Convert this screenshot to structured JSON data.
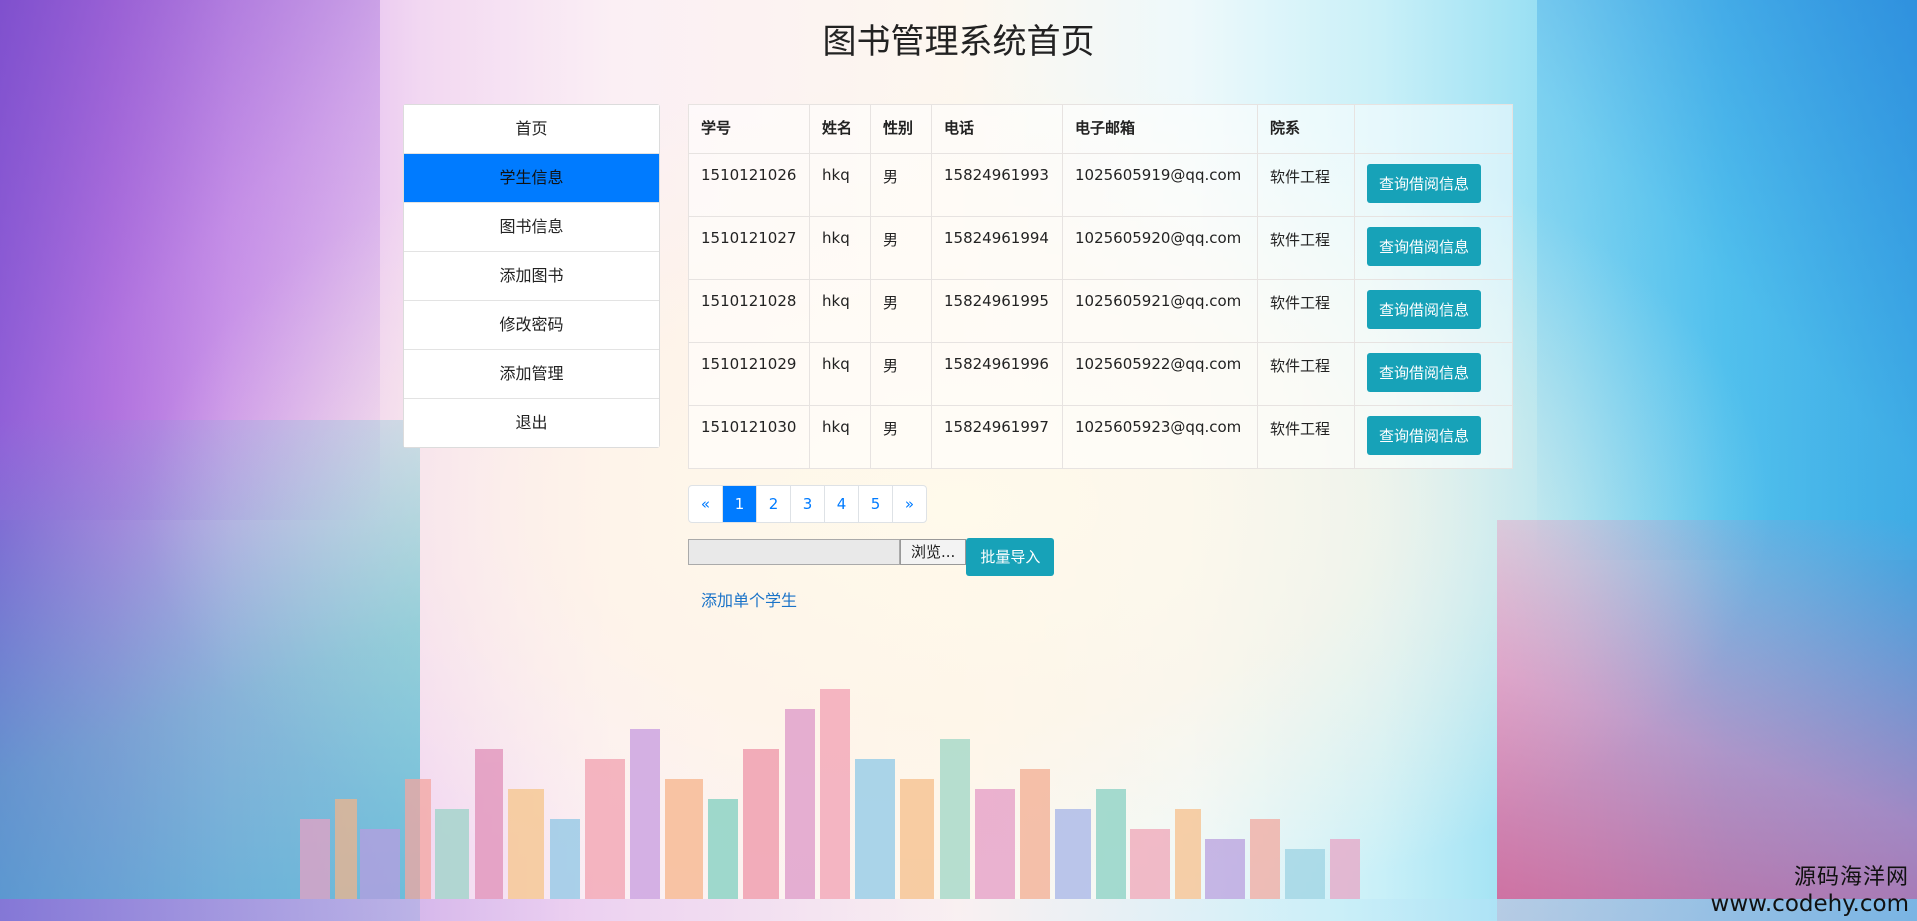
{
  "page": {
    "title": "图书管理系统首页"
  },
  "sidebar": {
    "items": [
      {
        "label": "首页",
        "active": false
      },
      {
        "label": "学生信息",
        "active": true
      },
      {
        "label": "图书信息",
        "active": false
      },
      {
        "label": "添加图书",
        "active": false
      },
      {
        "label": "修改密码",
        "active": false
      },
      {
        "label": "添加管理",
        "active": false
      },
      {
        "label": "退出",
        "active": false
      }
    ]
  },
  "table": {
    "headers": [
      "学号",
      "姓名",
      "性别",
      "电话",
      "电子邮箱",
      "院系",
      ""
    ],
    "action_label": "查询借阅信息",
    "rows": [
      {
        "id": "1510121026",
        "name": "hkq",
        "gender": "男",
        "phone": "15824961993",
        "email": "1025605919@qq.com",
        "dept": "软件工程"
      },
      {
        "id": "1510121027",
        "name": "hkq",
        "gender": "男",
        "phone": "15824961994",
        "email": "1025605920@qq.com",
        "dept": "软件工程"
      },
      {
        "id": "1510121028",
        "name": "hkq",
        "gender": "男",
        "phone": "15824961995",
        "email": "1025605921@qq.com",
        "dept": "软件工程"
      },
      {
        "id": "1510121029",
        "name": "hkq",
        "gender": "男",
        "phone": "15824961996",
        "email": "1025605922@qq.com",
        "dept": "软件工程"
      },
      {
        "id": "1510121030",
        "name": "hkq",
        "gender": "男",
        "phone": "15824961997",
        "email": "1025605923@qq.com",
        "dept": "软件工程"
      }
    ]
  },
  "pagination": {
    "prev": "«",
    "pages": [
      "1",
      "2",
      "3",
      "4",
      "5"
    ],
    "current": "1",
    "next": "»"
  },
  "import": {
    "browse_label": "浏览...",
    "import_label": "批量导入"
  },
  "add_student_link": "添加单个学生",
  "watermark": {
    "name": "源码海洋网",
    "url": "www.codehy.com"
  },
  "colors": {
    "primary": "#007bff",
    "info": "#17a2b8"
  }
}
